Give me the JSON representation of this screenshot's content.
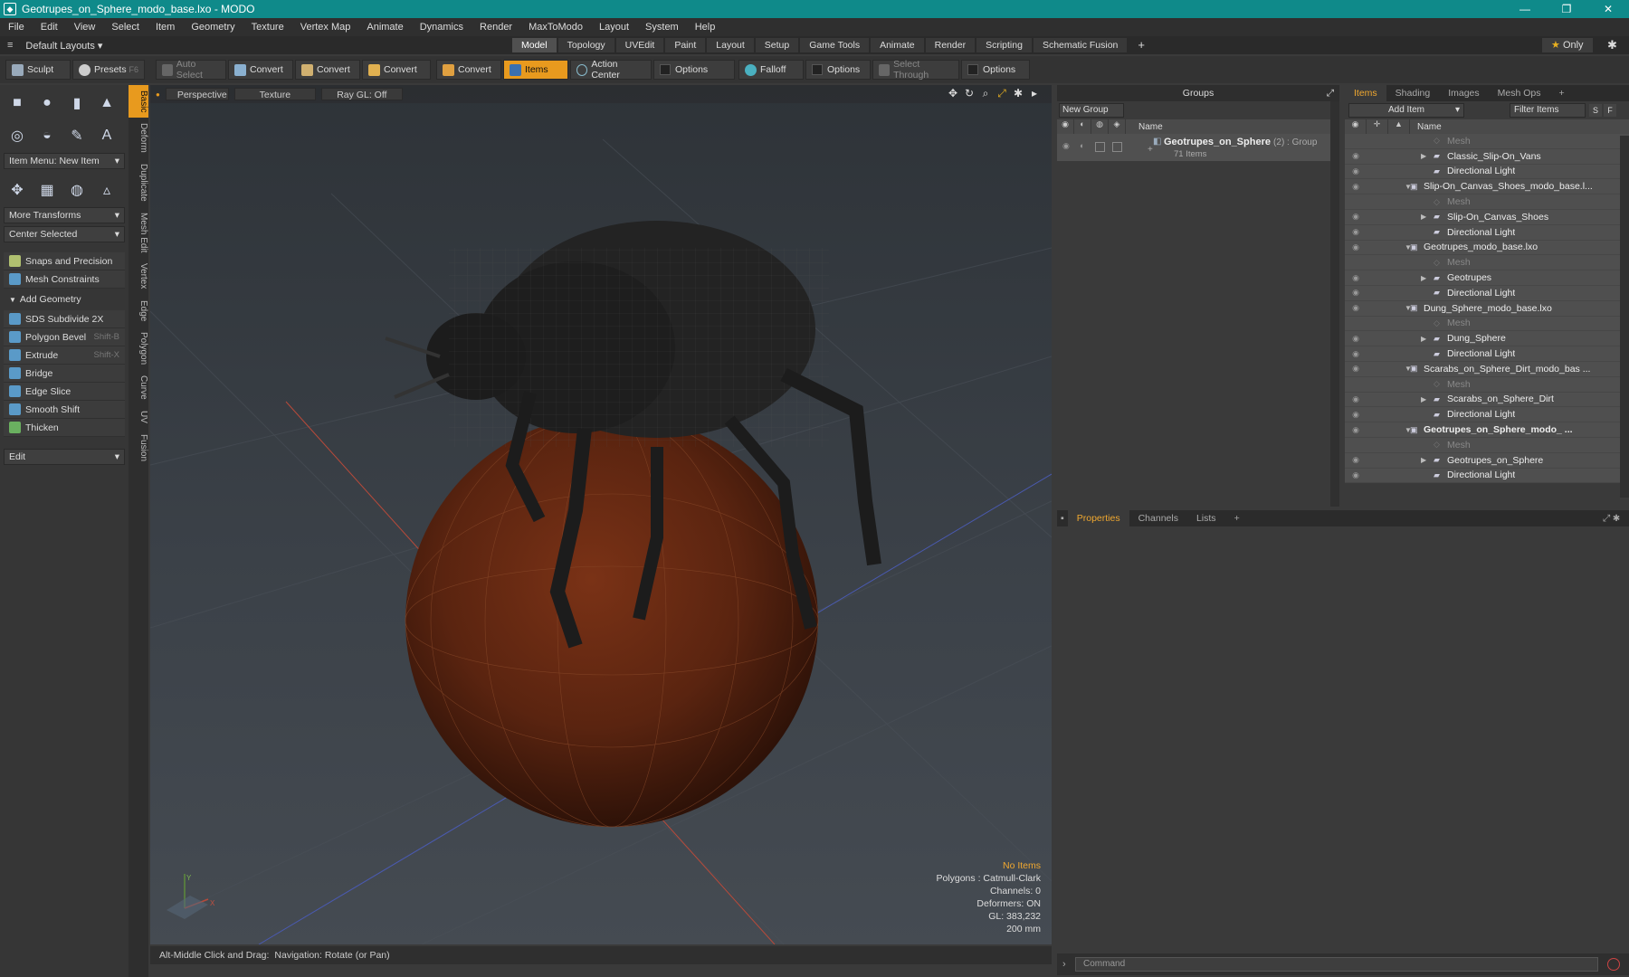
{
  "window": {
    "title": "Geotrupes_on_Sphere_modo_base.lxo - MODO",
    "controls": [
      "—",
      "❐",
      "✕"
    ]
  },
  "menu": [
    "File",
    "Edit",
    "View",
    "Select",
    "Item",
    "Geometry",
    "Texture",
    "Vertex Map",
    "Animate",
    "Dynamics",
    "Render",
    "MaxToModo",
    "Layout",
    "System",
    "Help"
  ],
  "layoutbar": {
    "layouts_label": "Default Layouts",
    "tabs": [
      "Model",
      "Topology",
      "UVEdit",
      "Paint",
      "Layout",
      "Setup",
      "Game Tools",
      "Animate",
      "Render",
      "Scripting",
      "Schematic Fusion"
    ],
    "active_tab": "Model",
    "only_label": "Only"
  },
  "toolbar": {
    "sculpt": "Sculpt",
    "presets": "Presets",
    "presets_key": "F6",
    "auto_select": "Auto Select",
    "convert1": "Convert",
    "convert2": "Convert",
    "convert3": "Convert",
    "convert4": "Convert",
    "items": "Items",
    "action_center": "Action Center",
    "options1": "Options",
    "falloff": "Falloff",
    "options2": "Options",
    "select_through": "Select Through",
    "options3": "Options"
  },
  "leftpanel": {
    "item_menu": "Item Menu: New Item",
    "more_transforms": "More Transforms",
    "center_selected": "Center Selected",
    "snaps": "Snaps and Precision",
    "mesh_constraints": "Mesh Constraints",
    "add_geometry": "Add Geometry",
    "tools": [
      {
        "label": "SDS Subdivide 2X",
        "shortcut": ""
      },
      {
        "label": "Polygon Bevel",
        "shortcut": "Shift-B"
      },
      {
        "label": "Extrude",
        "shortcut": "Shift-X"
      },
      {
        "label": "Bridge",
        "shortcut": ""
      },
      {
        "label": "Edge Slice",
        "shortcut": ""
      },
      {
        "label": "Smooth Shift",
        "shortcut": ""
      },
      {
        "label": "Thicken",
        "shortcut": ""
      }
    ],
    "edit": "Edit",
    "side_tabs": [
      "Basic",
      "Deform",
      "Duplicate",
      "Mesh Edit",
      "Vertex",
      "Edge",
      "Polygon",
      "Curve",
      "UV",
      "Fusion"
    ]
  },
  "viewport": {
    "view_mode": "Perspective",
    "shading": "Texture",
    "raygl": "Ray GL: Off",
    "info": {
      "selection": "No Items",
      "polygons": "Polygons : Catmull-Clark",
      "channels": "Channels: 0",
      "deformers": "Deformers: ON",
      "gl": "GL: 383,232",
      "scale": "200 mm"
    },
    "axis_labels": {
      "x": "X",
      "y": "Y"
    }
  },
  "statusbar": {
    "hint_key": "Alt-Middle Click and Drag:",
    "hint_text": "Navigation: Rotate (or Pan)"
  },
  "groups": {
    "title": "Groups",
    "new_group": "New Group",
    "name_col": "Name",
    "group_name": "Geotrupes_on_Sphere",
    "group_suffix": "(2) : Group",
    "group_count": "71 Items"
  },
  "items": {
    "tabs": [
      "Items",
      "Shading",
      "Images",
      "Mesh Ops"
    ],
    "add_item": "Add Item",
    "filter": "Filter Items",
    "name_col": "Name",
    "s": "S",
    "f": "F",
    "rows": [
      {
        "label": "Mesh",
        "indent": 2,
        "dim": true
      },
      {
        "label": "Classic_Slip-On_Vans",
        "indent": 2,
        "arrow": "▶"
      },
      {
        "label": "Directional Light",
        "indent": 2
      },
      {
        "label": "Slip-On_Canvas_Shoes_modo_base.l...",
        "indent": 1,
        "arrow": "▼"
      },
      {
        "label": "Mesh",
        "indent": 2,
        "dim": true
      },
      {
        "label": "Slip-On_Canvas_Shoes",
        "indent": 2,
        "arrow": "▶"
      },
      {
        "label": "Directional Light",
        "indent": 2
      },
      {
        "label": "Geotrupes_modo_base.lxo",
        "indent": 1,
        "arrow": "▼"
      },
      {
        "label": "Mesh",
        "indent": 2,
        "dim": true
      },
      {
        "label": "Geotrupes",
        "indent": 2,
        "arrow": "▶"
      },
      {
        "label": "Directional Light",
        "indent": 2
      },
      {
        "label": "Dung_Sphere_modo_base.lxo",
        "indent": 1,
        "arrow": "▼"
      },
      {
        "label": "Mesh",
        "indent": 2,
        "dim": true
      },
      {
        "label": "Dung_Sphere",
        "indent": 2,
        "arrow": "▶"
      },
      {
        "label": "Directional Light",
        "indent": 2
      },
      {
        "label": "Scarabs_on_Sphere_Dirt_modo_bas ...",
        "indent": 1,
        "arrow": "▼"
      },
      {
        "label": "Mesh",
        "indent": 2,
        "dim": true
      },
      {
        "label": "Scarabs_on_Sphere_Dirt",
        "indent": 2,
        "arrow": "▶"
      },
      {
        "label": "Directional Light",
        "indent": 2
      },
      {
        "label": "Geotrupes_on_Sphere_modo_ ...",
        "indent": 1,
        "arrow": "▼",
        "bold": true
      },
      {
        "label": "Mesh",
        "indent": 2,
        "dim": true
      },
      {
        "label": "Geotrupes_on_Sphere",
        "indent": 2,
        "arrow": "▶"
      },
      {
        "label": "Directional Light",
        "indent": 2
      }
    ]
  },
  "properties": {
    "tabs": [
      "Properties",
      "Channels",
      "Lists"
    ]
  },
  "command": {
    "placeholder": "Command"
  },
  "colors": {
    "accent": "#e89a1e",
    "titlebar": "#0f8a8a",
    "sphere": "#6a2a12"
  }
}
